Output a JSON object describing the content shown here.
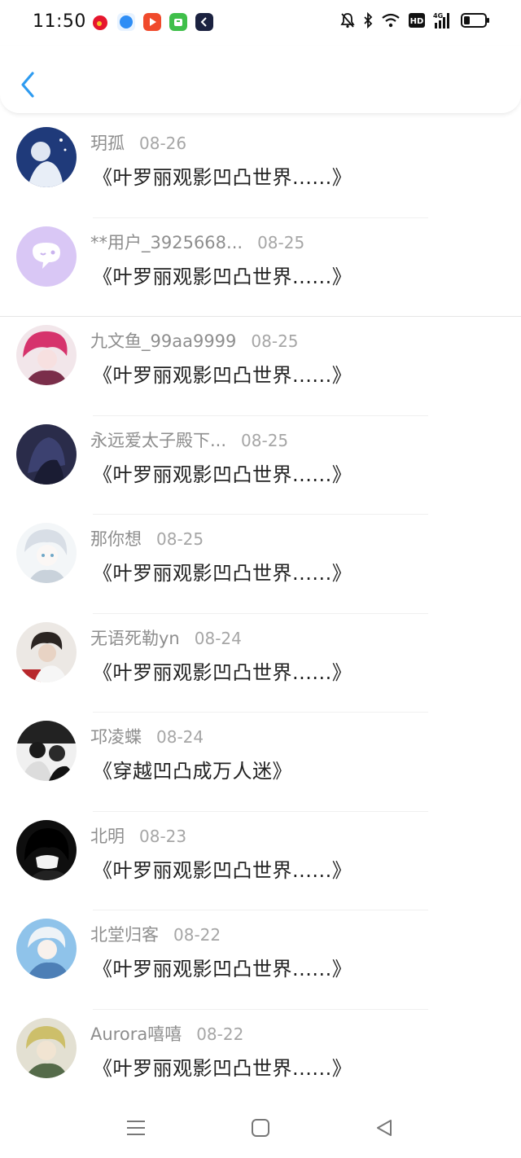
{
  "status_bar": {
    "time": "11:50",
    "hd_label": "HD",
    "network": "4G",
    "app_icons": [
      "weibo-app-icon",
      "blue-app-icon",
      "video-app-icon",
      "android-app-icon",
      "navy-app-icon"
    ],
    "sys_icons": [
      "mute-bell-icon",
      "bluetooth-icon",
      "wifi-icon",
      "hd-icon",
      "signal-icon",
      "battery-icon"
    ]
  },
  "header": {
    "back_icon": "back-arrow-icon"
  },
  "comments": [
    {
      "name": "玥孤",
      "date": "08-26",
      "title": "《叶罗丽观影凹凸世界......》"
    },
    {
      "name": "**用户_3925668...",
      "date": "08-25",
      "title": "《叶罗丽观影凹凸世界......》"
    },
    {
      "name": "九文鱼_99aa9999",
      "date": "08-25",
      "title": "《叶罗丽观影凹凸世界......》"
    },
    {
      "name": "永远爱太子殿下...",
      "date": "08-25",
      "title": "《叶罗丽观影凹凸世界......》"
    },
    {
      "name": "那你想",
      "date": "08-25",
      "title": "《叶罗丽观影凹凸世界......》"
    },
    {
      "name": "无语死勒yn",
      "date": "08-24",
      "title": "《叶罗丽观影凹凸世界......》"
    },
    {
      "name": "邛凌蝶",
      "date": "08-24",
      "title": "《穿越凹凸成万人迷》"
    },
    {
      "name": "北明",
      "date": "08-23",
      "title": "《叶罗丽观影凹凸世界......》"
    },
    {
      "name": "北堂归客",
      "date": "08-22",
      "title": "《叶罗丽观影凹凸世界......》"
    },
    {
      "name": "Aurora嘻嘻",
      "date": "08-22",
      "title": "《叶罗丽观影凹凸世界......》"
    }
  ],
  "nav_bar": {
    "icons": [
      "menu-icon",
      "home-icon",
      "back-triangle-icon"
    ]
  },
  "colors": {
    "accent": "#2e9bf0",
    "name": "#8e8e8e",
    "date": "#a6a6a6",
    "title": "#222222"
  }
}
